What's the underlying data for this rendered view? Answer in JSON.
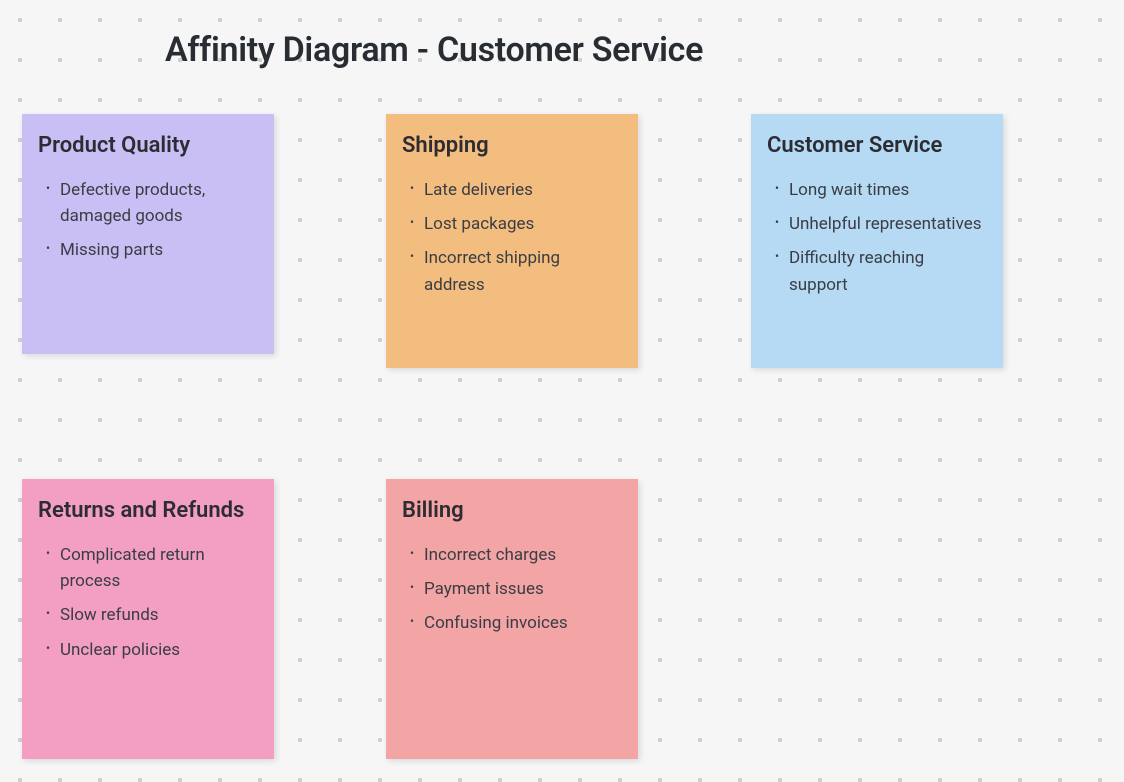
{
  "title": "Affinity Diagram - Customer Service",
  "colors": {
    "purple": "#C9BFF4",
    "orange": "#F3BD7F",
    "blue": "#B6D9F4",
    "pink": "#F39EC3",
    "salmon": "#F3A4A4"
  },
  "cards": [
    {
      "id": "product-quality",
      "title": "Product Quality",
      "items": [
        "Defective products, damaged goods",
        "Missing parts"
      ]
    },
    {
      "id": "shipping",
      "title": "Shipping",
      "items": [
        "Late deliveries",
        "Lost packages",
        "Incorrect shipping address"
      ]
    },
    {
      "id": "customer-service",
      "title": "Customer Service",
      "items": [
        "Long wait times",
        "Unhelpful representatives",
        "Difficulty reaching support"
      ]
    },
    {
      "id": "returns-refunds",
      "title": "Returns and Refunds",
      "items": [
        "Complicated return process",
        "Slow refunds",
        "Unclear policies"
      ]
    },
    {
      "id": "billing",
      "title": "Billing",
      "items": [
        "Incorrect charges",
        "Payment issues",
        "Confusing invoices"
      ]
    }
  ]
}
